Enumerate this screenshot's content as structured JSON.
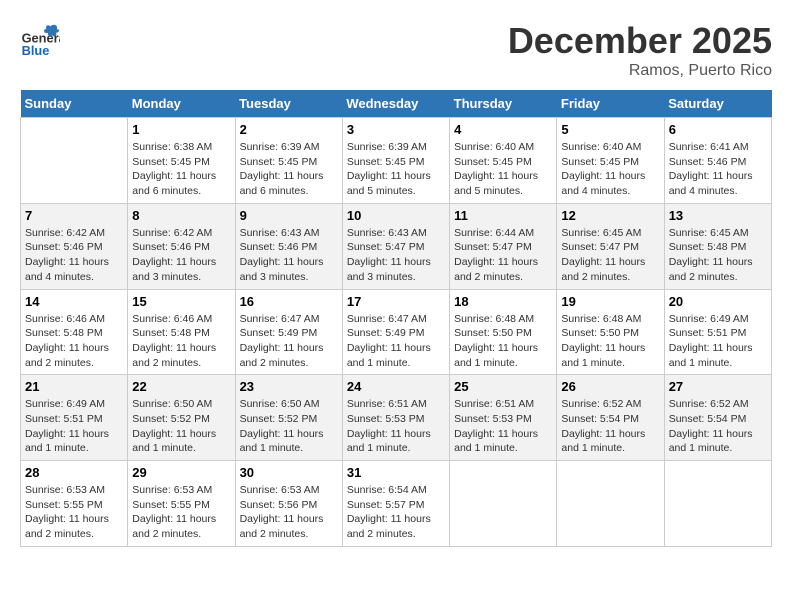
{
  "header": {
    "logo_general": "General",
    "logo_blue": "Blue",
    "month_title": "December 2025",
    "location": "Ramos, Puerto Rico"
  },
  "days_of_week": [
    "Sunday",
    "Monday",
    "Tuesday",
    "Wednesday",
    "Thursday",
    "Friday",
    "Saturday"
  ],
  "weeks": [
    [
      {
        "day": "",
        "info": ""
      },
      {
        "day": "1",
        "info": "Sunrise: 6:38 AM\nSunset: 5:45 PM\nDaylight: 11 hours and 6 minutes."
      },
      {
        "day": "2",
        "info": "Sunrise: 6:39 AM\nSunset: 5:45 PM\nDaylight: 11 hours and 6 minutes."
      },
      {
        "day": "3",
        "info": "Sunrise: 6:39 AM\nSunset: 5:45 PM\nDaylight: 11 hours and 5 minutes."
      },
      {
        "day": "4",
        "info": "Sunrise: 6:40 AM\nSunset: 5:45 PM\nDaylight: 11 hours and 5 minutes."
      },
      {
        "day": "5",
        "info": "Sunrise: 6:40 AM\nSunset: 5:45 PM\nDaylight: 11 hours and 4 minutes."
      },
      {
        "day": "6",
        "info": "Sunrise: 6:41 AM\nSunset: 5:46 PM\nDaylight: 11 hours and 4 minutes."
      }
    ],
    [
      {
        "day": "7",
        "info": "Sunrise: 6:42 AM\nSunset: 5:46 PM\nDaylight: 11 hours and 4 minutes."
      },
      {
        "day": "8",
        "info": "Sunrise: 6:42 AM\nSunset: 5:46 PM\nDaylight: 11 hours and 3 minutes."
      },
      {
        "day": "9",
        "info": "Sunrise: 6:43 AM\nSunset: 5:46 PM\nDaylight: 11 hours and 3 minutes."
      },
      {
        "day": "10",
        "info": "Sunrise: 6:43 AM\nSunset: 5:47 PM\nDaylight: 11 hours and 3 minutes."
      },
      {
        "day": "11",
        "info": "Sunrise: 6:44 AM\nSunset: 5:47 PM\nDaylight: 11 hours and 2 minutes."
      },
      {
        "day": "12",
        "info": "Sunrise: 6:45 AM\nSunset: 5:47 PM\nDaylight: 11 hours and 2 minutes."
      },
      {
        "day": "13",
        "info": "Sunrise: 6:45 AM\nSunset: 5:48 PM\nDaylight: 11 hours and 2 minutes."
      }
    ],
    [
      {
        "day": "14",
        "info": "Sunrise: 6:46 AM\nSunset: 5:48 PM\nDaylight: 11 hours and 2 minutes."
      },
      {
        "day": "15",
        "info": "Sunrise: 6:46 AM\nSunset: 5:48 PM\nDaylight: 11 hours and 2 minutes."
      },
      {
        "day": "16",
        "info": "Sunrise: 6:47 AM\nSunset: 5:49 PM\nDaylight: 11 hours and 2 minutes."
      },
      {
        "day": "17",
        "info": "Sunrise: 6:47 AM\nSunset: 5:49 PM\nDaylight: 11 hours and 1 minute."
      },
      {
        "day": "18",
        "info": "Sunrise: 6:48 AM\nSunset: 5:50 PM\nDaylight: 11 hours and 1 minute."
      },
      {
        "day": "19",
        "info": "Sunrise: 6:48 AM\nSunset: 5:50 PM\nDaylight: 11 hours and 1 minute."
      },
      {
        "day": "20",
        "info": "Sunrise: 6:49 AM\nSunset: 5:51 PM\nDaylight: 11 hours and 1 minute."
      }
    ],
    [
      {
        "day": "21",
        "info": "Sunrise: 6:49 AM\nSunset: 5:51 PM\nDaylight: 11 hours and 1 minute."
      },
      {
        "day": "22",
        "info": "Sunrise: 6:50 AM\nSunset: 5:52 PM\nDaylight: 11 hours and 1 minute."
      },
      {
        "day": "23",
        "info": "Sunrise: 6:50 AM\nSunset: 5:52 PM\nDaylight: 11 hours and 1 minute."
      },
      {
        "day": "24",
        "info": "Sunrise: 6:51 AM\nSunset: 5:53 PM\nDaylight: 11 hours and 1 minute."
      },
      {
        "day": "25",
        "info": "Sunrise: 6:51 AM\nSunset: 5:53 PM\nDaylight: 11 hours and 1 minute."
      },
      {
        "day": "26",
        "info": "Sunrise: 6:52 AM\nSunset: 5:54 PM\nDaylight: 11 hours and 1 minute."
      },
      {
        "day": "27",
        "info": "Sunrise: 6:52 AM\nSunset: 5:54 PM\nDaylight: 11 hours and 1 minute."
      }
    ],
    [
      {
        "day": "28",
        "info": "Sunrise: 6:53 AM\nSunset: 5:55 PM\nDaylight: 11 hours and 2 minutes."
      },
      {
        "day": "29",
        "info": "Sunrise: 6:53 AM\nSunset: 5:55 PM\nDaylight: 11 hours and 2 minutes."
      },
      {
        "day": "30",
        "info": "Sunrise: 6:53 AM\nSunset: 5:56 PM\nDaylight: 11 hours and 2 minutes."
      },
      {
        "day": "31",
        "info": "Sunrise: 6:54 AM\nSunset: 5:57 PM\nDaylight: 11 hours and 2 minutes."
      },
      {
        "day": "",
        "info": ""
      },
      {
        "day": "",
        "info": ""
      },
      {
        "day": "",
        "info": ""
      }
    ]
  ]
}
